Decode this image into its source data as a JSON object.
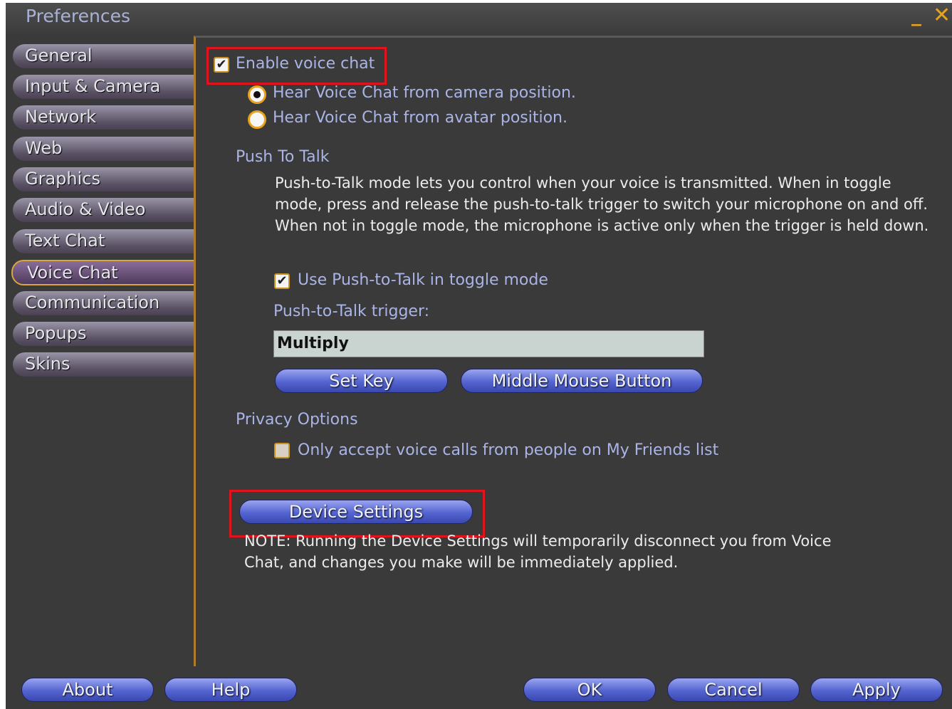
{
  "window": {
    "title": "Preferences",
    "minimize_glyph": "_",
    "close_glyph": "✕",
    "accent_color": "#e8a21c"
  },
  "sidebar": {
    "tabs": [
      {
        "label": "General"
      },
      {
        "label": "Input & Camera"
      },
      {
        "label": "Network"
      },
      {
        "label": "Web"
      },
      {
        "label": "Graphics"
      },
      {
        "label": "Audio & Video"
      },
      {
        "label": "Text Chat"
      },
      {
        "label": "Voice Chat",
        "selected": true
      },
      {
        "label": "Communication"
      },
      {
        "label": "Popups"
      },
      {
        "label": "Skins"
      }
    ]
  },
  "voice": {
    "enable_label": "Enable voice chat",
    "enable_checked": true,
    "radio_camera": "Hear Voice Chat from camera position.",
    "radio_avatar": "Hear Voice Chat from avatar position.",
    "radio_selected": "camera"
  },
  "ptt": {
    "section_title": "Push To Talk",
    "description": "Push-to-Talk mode lets you control when your voice is transmitted. When in toggle mode, press and release the push-to-talk trigger to switch your microphone on and off. When not in toggle mode, the microphone is active only when the trigger is held down.",
    "toggle_label": "Use Push-to-Talk in toggle mode",
    "toggle_checked": true,
    "trigger_label": "Push-to-Talk trigger:",
    "trigger_value": "Multiply",
    "set_key_label": "Set Key",
    "middle_mouse_label": "Middle Mouse Button"
  },
  "privacy": {
    "section_title": "Privacy Options",
    "friends_only_label": "Only accept voice calls from people on My Friends list",
    "friends_only_checked": false
  },
  "device": {
    "button_label": "Device Settings",
    "note": "NOTE: Running the Device Settings will temporarily disconnect you from Voice Chat, and changes you make will be immediately applied."
  },
  "footer": {
    "about_label": "About",
    "help_label": "Help",
    "ok_label": "OK",
    "cancel_label": "Cancel",
    "apply_label": "Apply"
  },
  "icons": {
    "checkmark": "✔"
  }
}
